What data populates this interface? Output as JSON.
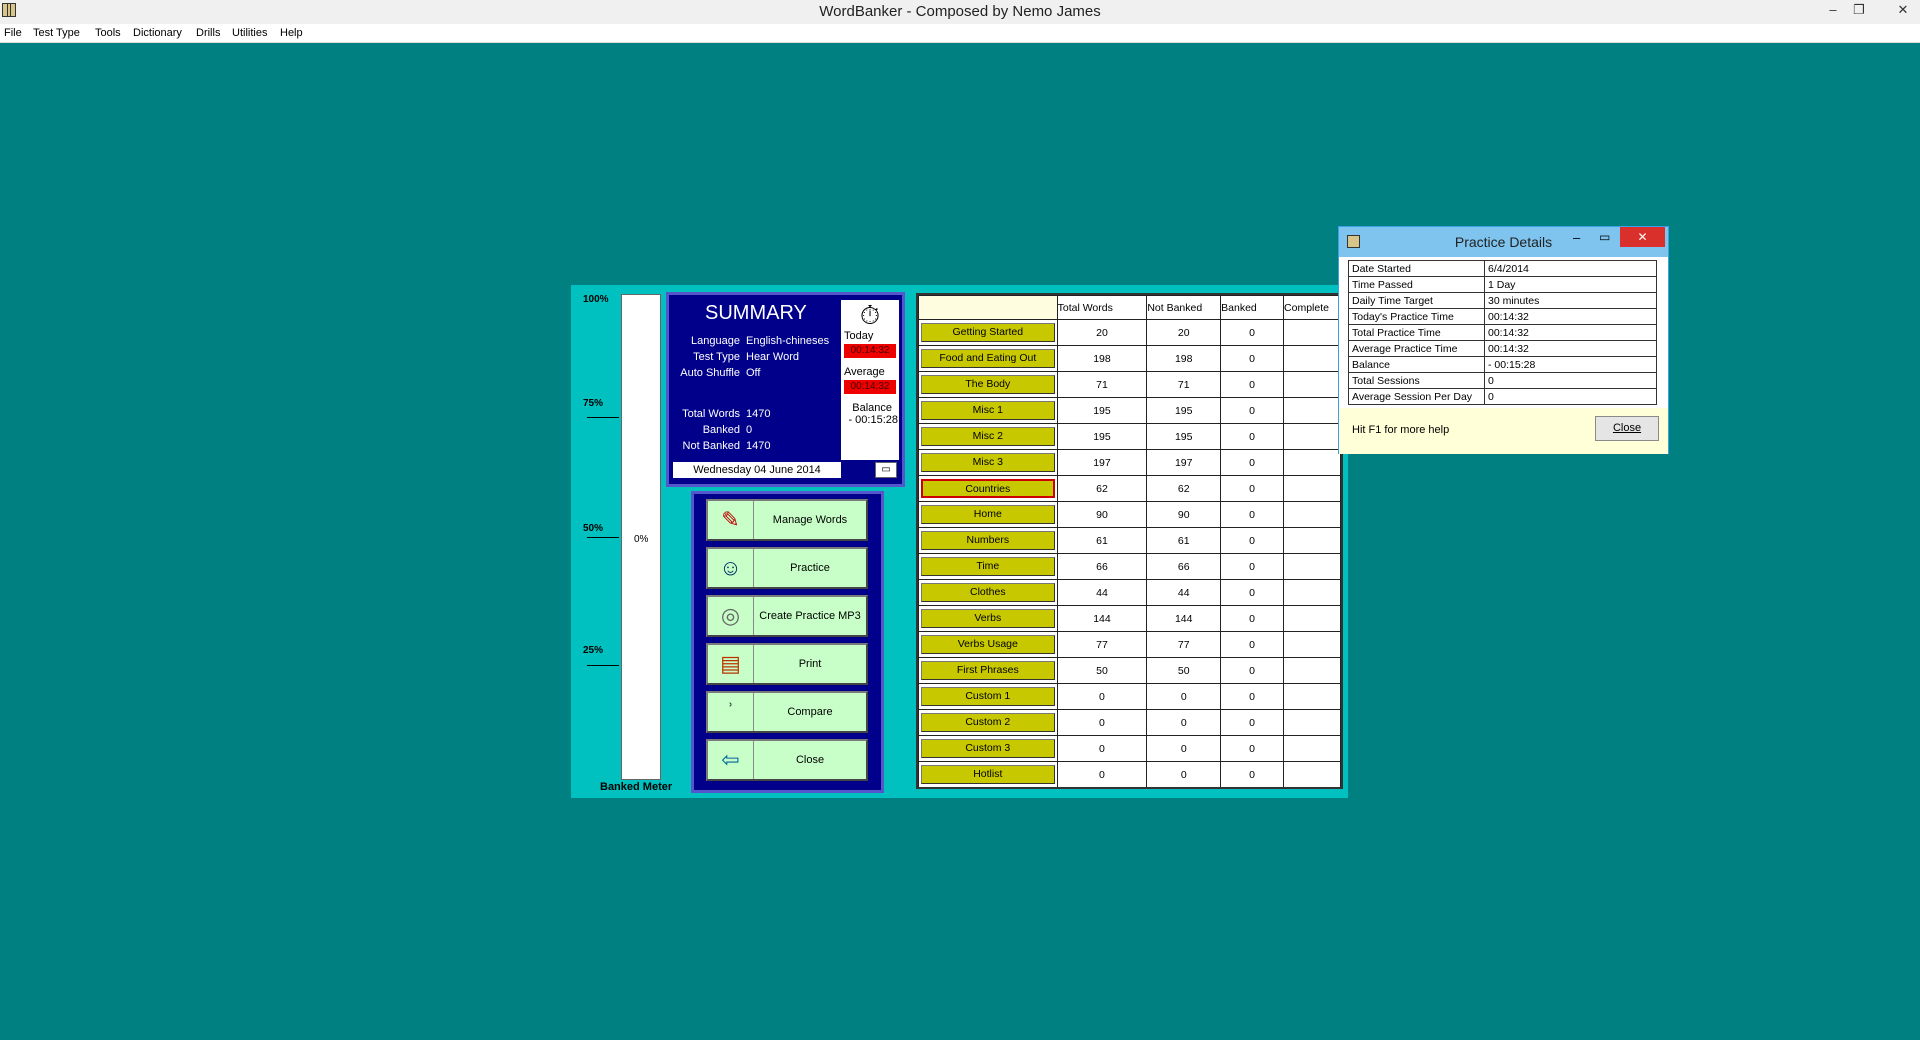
{
  "window": {
    "title": "WordBanker - Composed by Nemo James",
    "minimize": "–",
    "restore": "❐",
    "close": "✕"
  },
  "menu": [
    "File",
    "Test Type",
    "Tools",
    "Dictionary",
    "Drills",
    "Utilities",
    "Help"
  ],
  "meter": {
    "labels": [
      "100%",
      "75%",
      "50%",
      "25%"
    ],
    "value": "0%",
    "title": "Banked Meter",
    "fill": 0
  },
  "summary": {
    "title": "SUMMARY",
    "fields": [
      {
        "label": "Language",
        "value": "English-chineses"
      },
      {
        "label": "Test Type",
        "value": "Hear Word"
      },
      {
        "label": "Auto Shuffle",
        "value": "Off"
      }
    ],
    "counts": [
      {
        "label": "Total Words",
        "value": "1470"
      },
      {
        "label": "Banked",
        "value": "0"
      },
      {
        "label": "Not Banked",
        "value": "1470"
      }
    ],
    "date": "Wednesday 04 June 2014",
    "today_label": "Today",
    "today_time": "00:14:32",
    "average_label": "Average",
    "average_time": "00:14:32",
    "balance_label": "Balance",
    "balance_value": "- 00:15:28"
  },
  "buttons": [
    {
      "label": "Manage Words",
      "icon": "manage-words-icon",
      "glyph": "✎"
    },
    {
      "label": "Practice",
      "icon": "practice-icon",
      "glyph": "☺"
    },
    {
      "label": "Create Practice MP3",
      "icon": "cd-icon",
      "glyph": "◎"
    },
    {
      "label": "Print",
      "icon": "print-icon",
      "glyph": "▤"
    },
    {
      "label": "Compare",
      "icon": "ear-icon",
      "glyph": "ʾ"
    },
    {
      "label": "Close",
      "icon": "door-icon",
      "glyph": "⇦"
    }
  ],
  "table": {
    "headers": [
      "",
      "Total Words",
      "Not Banked",
      "Banked",
      "Complete"
    ],
    "rows": [
      {
        "name": "Getting Started",
        "total": "20",
        "not_banked": "20",
        "banked": "0",
        "complete": ""
      },
      {
        "name": "Food and Eating Out",
        "total": "198",
        "not_banked": "198",
        "banked": "0",
        "complete": ""
      },
      {
        "name": "The Body",
        "total": "71",
        "not_banked": "71",
        "banked": "0",
        "complete": ""
      },
      {
        "name": "Misc 1",
        "total": "195",
        "not_banked": "195",
        "banked": "0",
        "complete": ""
      },
      {
        "name": "Misc 2",
        "total": "195",
        "not_banked": "195",
        "banked": "0",
        "complete": ""
      },
      {
        "name": "Misc 3",
        "total": "197",
        "not_banked": "197",
        "banked": "0",
        "complete": ""
      },
      {
        "name": "Countries",
        "total": "62",
        "not_banked": "62",
        "banked": "0",
        "complete": "",
        "selected": true
      },
      {
        "name": "Home",
        "total": "90",
        "not_banked": "90",
        "banked": "0",
        "complete": ""
      },
      {
        "name": "Numbers",
        "total": "61",
        "not_banked": "61",
        "banked": "0",
        "complete": ""
      },
      {
        "name": "Time",
        "total": "66",
        "not_banked": "66",
        "banked": "0",
        "complete": ""
      },
      {
        "name": "Clothes",
        "total": "44",
        "not_banked": "44",
        "banked": "0",
        "complete": ""
      },
      {
        "name": "Verbs",
        "total": "144",
        "not_banked": "144",
        "banked": "0",
        "complete": ""
      },
      {
        "name": "Verbs Usage",
        "total": "77",
        "not_banked": "77",
        "banked": "0",
        "complete": ""
      },
      {
        "name": "First Phrases",
        "total": "50",
        "not_banked": "50",
        "banked": "0",
        "complete": ""
      },
      {
        "name": "Custom 1",
        "total": "0",
        "not_banked": "0",
        "banked": "0",
        "complete": ""
      },
      {
        "name": "Custom 2",
        "total": "0",
        "not_banked": "0",
        "banked": "0",
        "complete": ""
      },
      {
        "name": "Custom 3",
        "total": "0",
        "not_banked": "0",
        "banked": "0",
        "complete": ""
      },
      {
        "name": "Hotlist",
        "total": "0",
        "not_banked": "0",
        "banked": "0",
        "complete": ""
      }
    ]
  },
  "practice_details": {
    "title": "Practice Details",
    "rows": [
      {
        "label": "Date Started",
        "value": "6/4/2014"
      },
      {
        "label": "Time Passed",
        "value": "1 Day"
      },
      {
        "label": "Daily Time Target",
        "value": "30 minutes"
      },
      {
        "label": "Today's Practice Time",
        "value": "00:14:32"
      },
      {
        "label": "Total Practice Time",
        "value": "00:14:32"
      },
      {
        "label": "Average Practice Time",
        "value": "00:14:32"
      },
      {
        "label": "Balance",
        "value": "- 00:15:28"
      },
      {
        "label": "Total Sessions",
        "value": "0"
      },
      {
        "label": "Average Session Per Day",
        "value": "0"
      }
    ],
    "help_text": "Hit F1 for more help",
    "close_label": "Close"
  }
}
